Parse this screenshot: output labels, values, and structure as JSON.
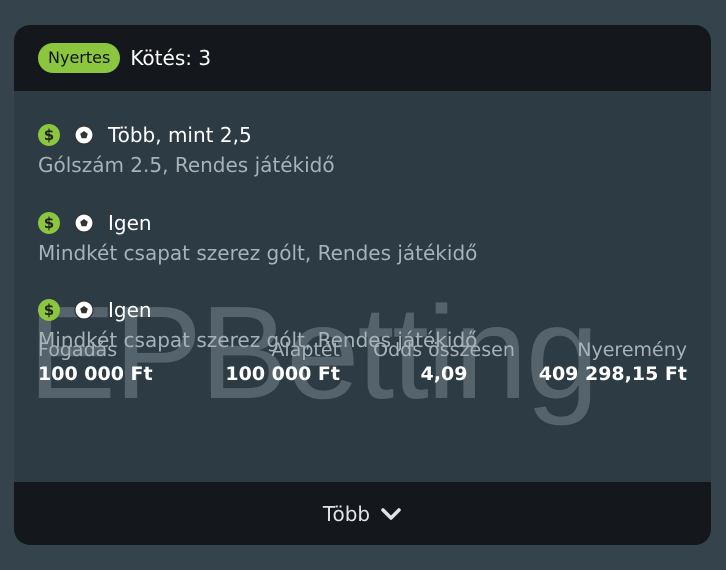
{
  "header": {
    "badge": "Nyertes",
    "bet_count": "Kötés: 3"
  },
  "selections": [
    {
      "name": "Több, mint 2,5",
      "market": "Gólszám 2.5, Rendes játékidő",
      "icons": [
        "dollar-icon",
        "soccer-ball-icon"
      ]
    },
    {
      "name": "Igen",
      "market": "Mindkét csapat szerez gólt, Rendes játékidő",
      "icons": [
        "dollar-icon",
        "soccer-ball-icon"
      ]
    },
    {
      "name": "Igen",
      "market": "Mindkét csapat szerez gólt, Rendes játékidő",
      "icons": [
        "dollar-icon",
        "soccer-ball-icon"
      ]
    }
  ],
  "watermark": "EPBetting",
  "stats": {
    "stake": {
      "label": "Fogadás",
      "value": "100 000 Ft"
    },
    "base_stake": {
      "label": "Alaptét",
      "value": "100 000 Ft"
    },
    "total_odds": {
      "label": "Odds összesen",
      "value": "4,09"
    },
    "winnings": {
      "label": "Nyeremény",
      "value": "409 298,15 Ft"
    }
  },
  "footer": {
    "more_label": "Több"
  },
  "colors": {
    "accent": "#8cc63e",
    "header_bg": "#14181c",
    "body_bg": "#2c3b44",
    "page_bg": "#34434c"
  }
}
